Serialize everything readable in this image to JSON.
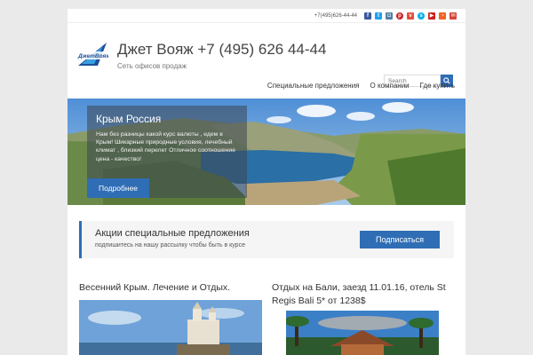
{
  "topbar": {
    "phone": "+7(495)626-44-44",
    "social_icons": [
      "facebook-icon",
      "twitter-icon",
      "instagram-icon",
      "pinterest-icon",
      "vk-icon",
      "skype-icon",
      "youtube-icon",
      "rss-icon",
      "mail-icon"
    ]
  },
  "header": {
    "title": "Джет Вояж +7 (495) 626 44-44",
    "tagline": "Сеть офисов продаж",
    "search_placeholder": "Search"
  },
  "nav": {
    "items": [
      "Специальные предложения",
      "О компании",
      "Где купить"
    ]
  },
  "slider": {
    "title": "Крым Россия",
    "text": "Нам без разницы какой курс валюты , едем в Крым! Шикарные природные условия, лечебный климат , близкий перелет Отличное соотношение цена - качество!",
    "button": "Подробнее"
  },
  "promo": {
    "title": "Акции специальные предложения",
    "subtitle": "подпишитесь на нашу рассылку чтобы быть в курсе",
    "button": "Подписаться"
  },
  "posts": [
    {
      "title": "Весенний Крым. Лечение и Отдых."
    },
    {
      "title": "Отдых на Бали, заезд 11.01.16, отель St Regis Bali 5* от 1238$"
    }
  ],
  "colors": {
    "accent": "#2f6db5",
    "background": "#eaeaea"
  }
}
